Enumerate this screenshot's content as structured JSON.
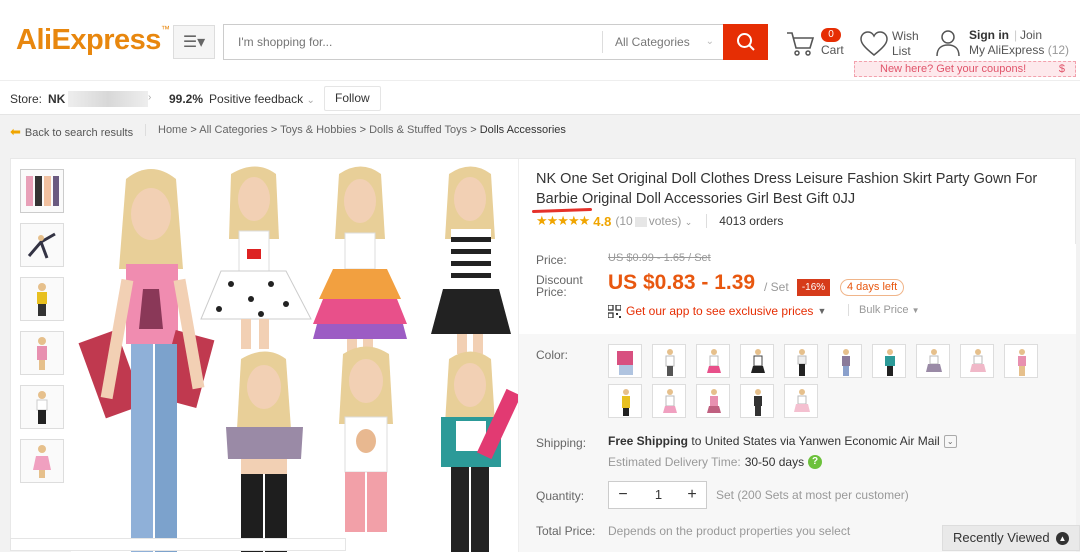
{
  "header": {
    "logo": "AliExpress",
    "search_placeholder": "I'm shopping for...",
    "categories_label": "All Categories",
    "cart_count": "0",
    "cart_label": "Cart",
    "wish_label_1": "Wish",
    "wish_label_2": "List",
    "signin": "Sign in",
    "join": "Join",
    "my_aliexpress": "My AliExpress",
    "my_count": "(12)",
    "coupon_text": "New here? Get your coupons!",
    "coupon_symbol": "$"
  },
  "store": {
    "label": "Store:",
    "name": "NK",
    "feedback_pct": "99.2%",
    "feedback_label": "Positive feedback",
    "follow_label": "Follow"
  },
  "breadcrumb": {
    "back": "Back to search results",
    "items": [
      "Home",
      "All Categories",
      "Toys & Hobbies",
      "Dolls & Stuffed Toys"
    ],
    "current": "Dolls Accessories"
  },
  "product": {
    "title": "NK One Set Original Doll Clothes Dress Leisure Fashion Skirt Party Gown For Barbie Original Doll Accessories Girl Best Gift 0JJ",
    "stars": "★★★★★",
    "rating": "4.8",
    "votes": "(10",
    "votes_end": "votes)",
    "orders": "4013 orders",
    "price_label": "Price:",
    "old_price": "US $0.99 - 1.65 / Set",
    "discount_label_1": "Discount",
    "discount_label_2": "Price:",
    "new_price": "US $0.83 - 1.39",
    "per_set": "/ Set",
    "discount_pct": "-16%",
    "days_left": "4 days left",
    "app_offer": "Get our app to see exclusive prices",
    "bulk_price": "Bulk Price",
    "color_label": "Color:",
    "shipping_label": "Shipping:",
    "shipping_main": "Free Shipping",
    "shipping_rest": "to United States via Yanwen Economic Air Mail",
    "eta_label": "Estimated Delivery Time:",
    "eta_value": "30-50 days",
    "quantity_label": "Quantity:",
    "quantity_value": "1",
    "quantity_note": "Set (200 Sets at most per customer)",
    "total_label": "Total Price:",
    "total_note": "Depends on the product properties you select"
  },
  "recently_viewed": "Recently Viewed",
  "colors": {
    "brand_orange": "#e8870e",
    "search_red": "#e62e04",
    "price_orange": "#e8570f"
  }
}
